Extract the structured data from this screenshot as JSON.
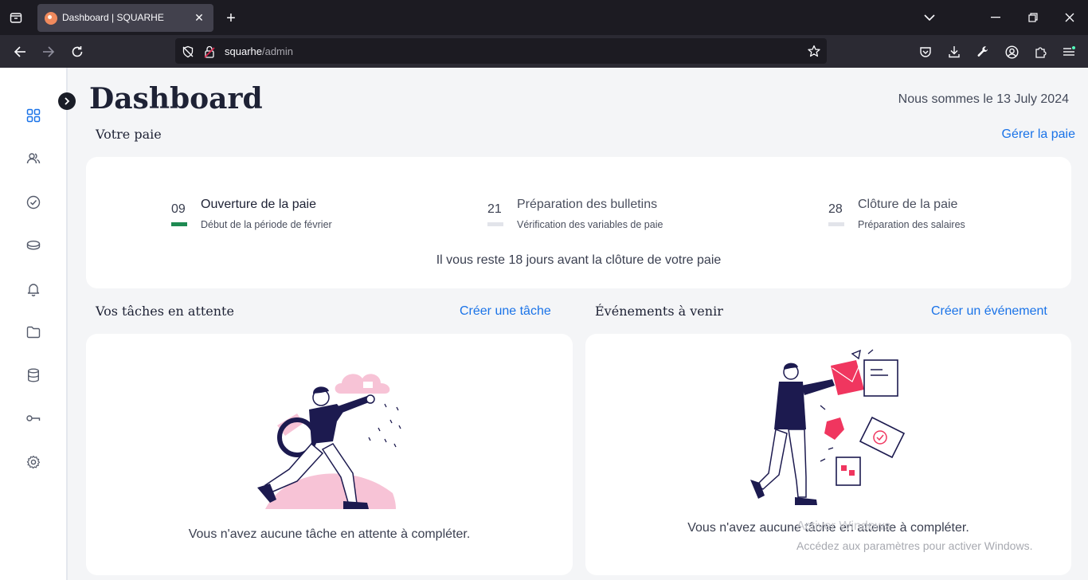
{
  "browser": {
    "tab_title": "Dashboard | SQUARHE",
    "url_host": "squarhe",
    "url_path": "/admin"
  },
  "sidebar": {
    "items": [
      {
        "icon": "grid-icon",
        "active": true
      },
      {
        "icon": "users-icon"
      },
      {
        "icon": "check-circle-icon"
      },
      {
        "icon": "coins-icon"
      },
      {
        "icon": "bell-icon"
      },
      {
        "icon": "folder-icon"
      },
      {
        "icon": "database-icon"
      },
      {
        "icon": "key-icon"
      },
      {
        "icon": "gear-icon"
      }
    ]
  },
  "header": {
    "title": "Dashboard",
    "date_text": "Nous sommes le 13 July 2024"
  },
  "payroll": {
    "section_title": "Votre paie",
    "manage_link": "Gérer la paie",
    "steps": [
      {
        "num": "09",
        "title": "Ouverture de la paie",
        "subtitle": "Début de la période de février",
        "active": true
      },
      {
        "num": "21",
        "title": "Préparation des bulletins",
        "subtitle": "Vérification des variables de paie",
        "active": false
      },
      {
        "num": "28",
        "title": "Clôture de la paie",
        "subtitle": "Préparation des salaires",
        "active": false
      }
    ],
    "remaining_text": "Il vous reste 18 jours avant la clôture de votre paie"
  },
  "tasks": {
    "section_title": "Vos tâches en attente",
    "create_link": "Créer une tâche",
    "empty_message": "Vous n'avez aucune tâche en attente à compléter."
  },
  "events": {
    "section_title": "Événements à venir",
    "create_link": "Créer un événement",
    "empty_message": "Vous n'avez aucune tâche en attente à compléter."
  },
  "watermark": {
    "line1": "Activer Windows",
    "line2": "Accédez aux paramètres pour activer Windows."
  },
  "colors": {
    "accent": "#1a73e8",
    "active_step": "#1e8a52",
    "illustration_pink": "#f7c3d6",
    "illustration_red": "#f0365f",
    "illustration_navy": "#1c1a4f"
  }
}
